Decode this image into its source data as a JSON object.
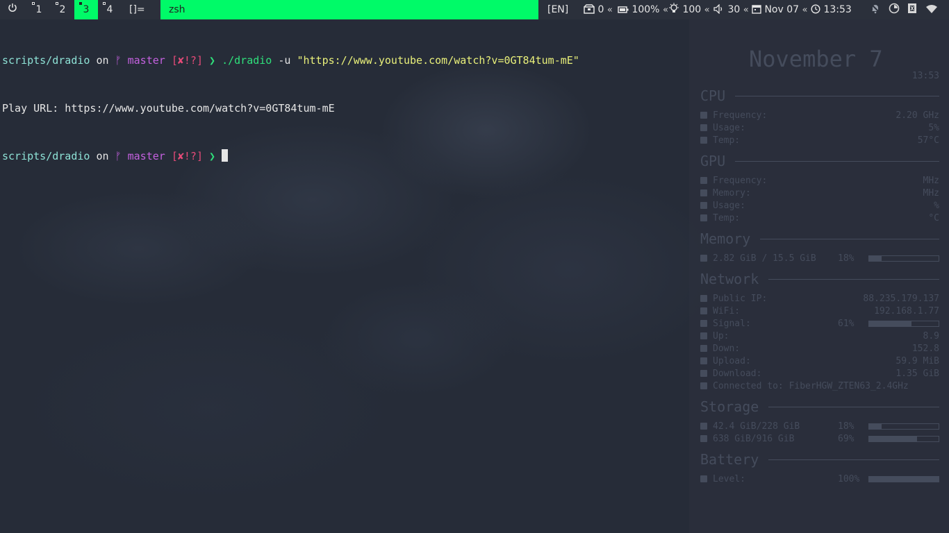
{
  "topbar": {
    "workspaces": [
      {
        "label": "1",
        "active": false
      },
      {
        "label": "2",
        "active": false
      },
      {
        "label": "3",
        "active": true
      },
      {
        "label": "4",
        "active": false
      }
    ],
    "layout_symbol": "[]=",
    "window_title": "zsh",
    "accent_color": "#00fa68",
    "status": {
      "lang": "[EN]",
      "updates": "0",
      "battery": "100%",
      "brightness": "100",
      "volume": "30",
      "date": "Nov 07",
      "time": "13:53",
      "separator": "«"
    }
  },
  "terminal": {
    "lines": [
      {
        "dir": "scripts/dradio",
        "on": "on",
        "branch_icon": "ᚠ",
        "branch": "master",
        "status": "[✘!?]",
        "arrow": "❯",
        "cmd": "./dradio",
        "flag": "-u",
        "str": "\"https://www.youtube.com/watch?v=0GT84tum-mE\""
      },
      {
        "output": "Play URL: https://www.youtube.com/watch?v=0GT84tum-mE"
      },
      {
        "dir": "scripts/dradio",
        "on": "on",
        "branch_icon": "ᚠ",
        "branch": "master",
        "status": "[✘!?]",
        "arrow": "❯"
      }
    ]
  },
  "conky": {
    "date": "November 7",
    "time": "13:53",
    "cpu": {
      "title": "CPU",
      "frequency_label": "Frequency:",
      "frequency": "2.20 GHz",
      "usage_label": "Usage:",
      "usage": "5%",
      "temp_label": "Temp:",
      "temp": "57°C"
    },
    "gpu": {
      "title": "GPU",
      "frequency_label": "Frequency:",
      "frequency": "MHz",
      "memory_label": "Memory:",
      "memory": "MHz",
      "usage_label": "Usage:",
      "usage": "%",
      "temp_label": "Temp:",
      "temp": "°C"
    },
    "memory": {
      "title": "Memory",
      "text": "2.82 GiB / 15.5 GiB",
      "pct": "18%",
      "level": 0.18
    },
    "network": {
      "title": "Network",
      "public_ip_label": "Public IP:",
      "public_ip": "88.235.179.137",
      "wifi_label": "WiFi:",
      "wifi": "192.168.1.77",
      "signal_label": "Signal:",
      "signal": "61%",
      "signal_level": 0.61,
      "up_label": "Up:",
      "up": "8.9",
      "down_label": "Down:",
      "down": "152.8",
      "upload_label": "Upload:",
      "upload": "59.9 MiB",
      "download_label": "Download:",
      "download": "1.35 GiB",
      "connected": "Connected to: FiberHGW_ZTEN63_2.4GHz"
    },
    "storage": {
      "title": "Storage",
      "disks": [
        {
          "text": "42.4 GiB/228 GiB",
          "pct": "18%",
          "level": 0.18
        },
        {
          "text": "638 GiB/916 GiB",
          "pct": "69%",
          "level": 0.69
        }
      ]
    },
    "battery": {
      "title": "Battery",
      "level_label": "Level:",
      "pct": "100%",
      "level": 1.0
    }
  }
}
